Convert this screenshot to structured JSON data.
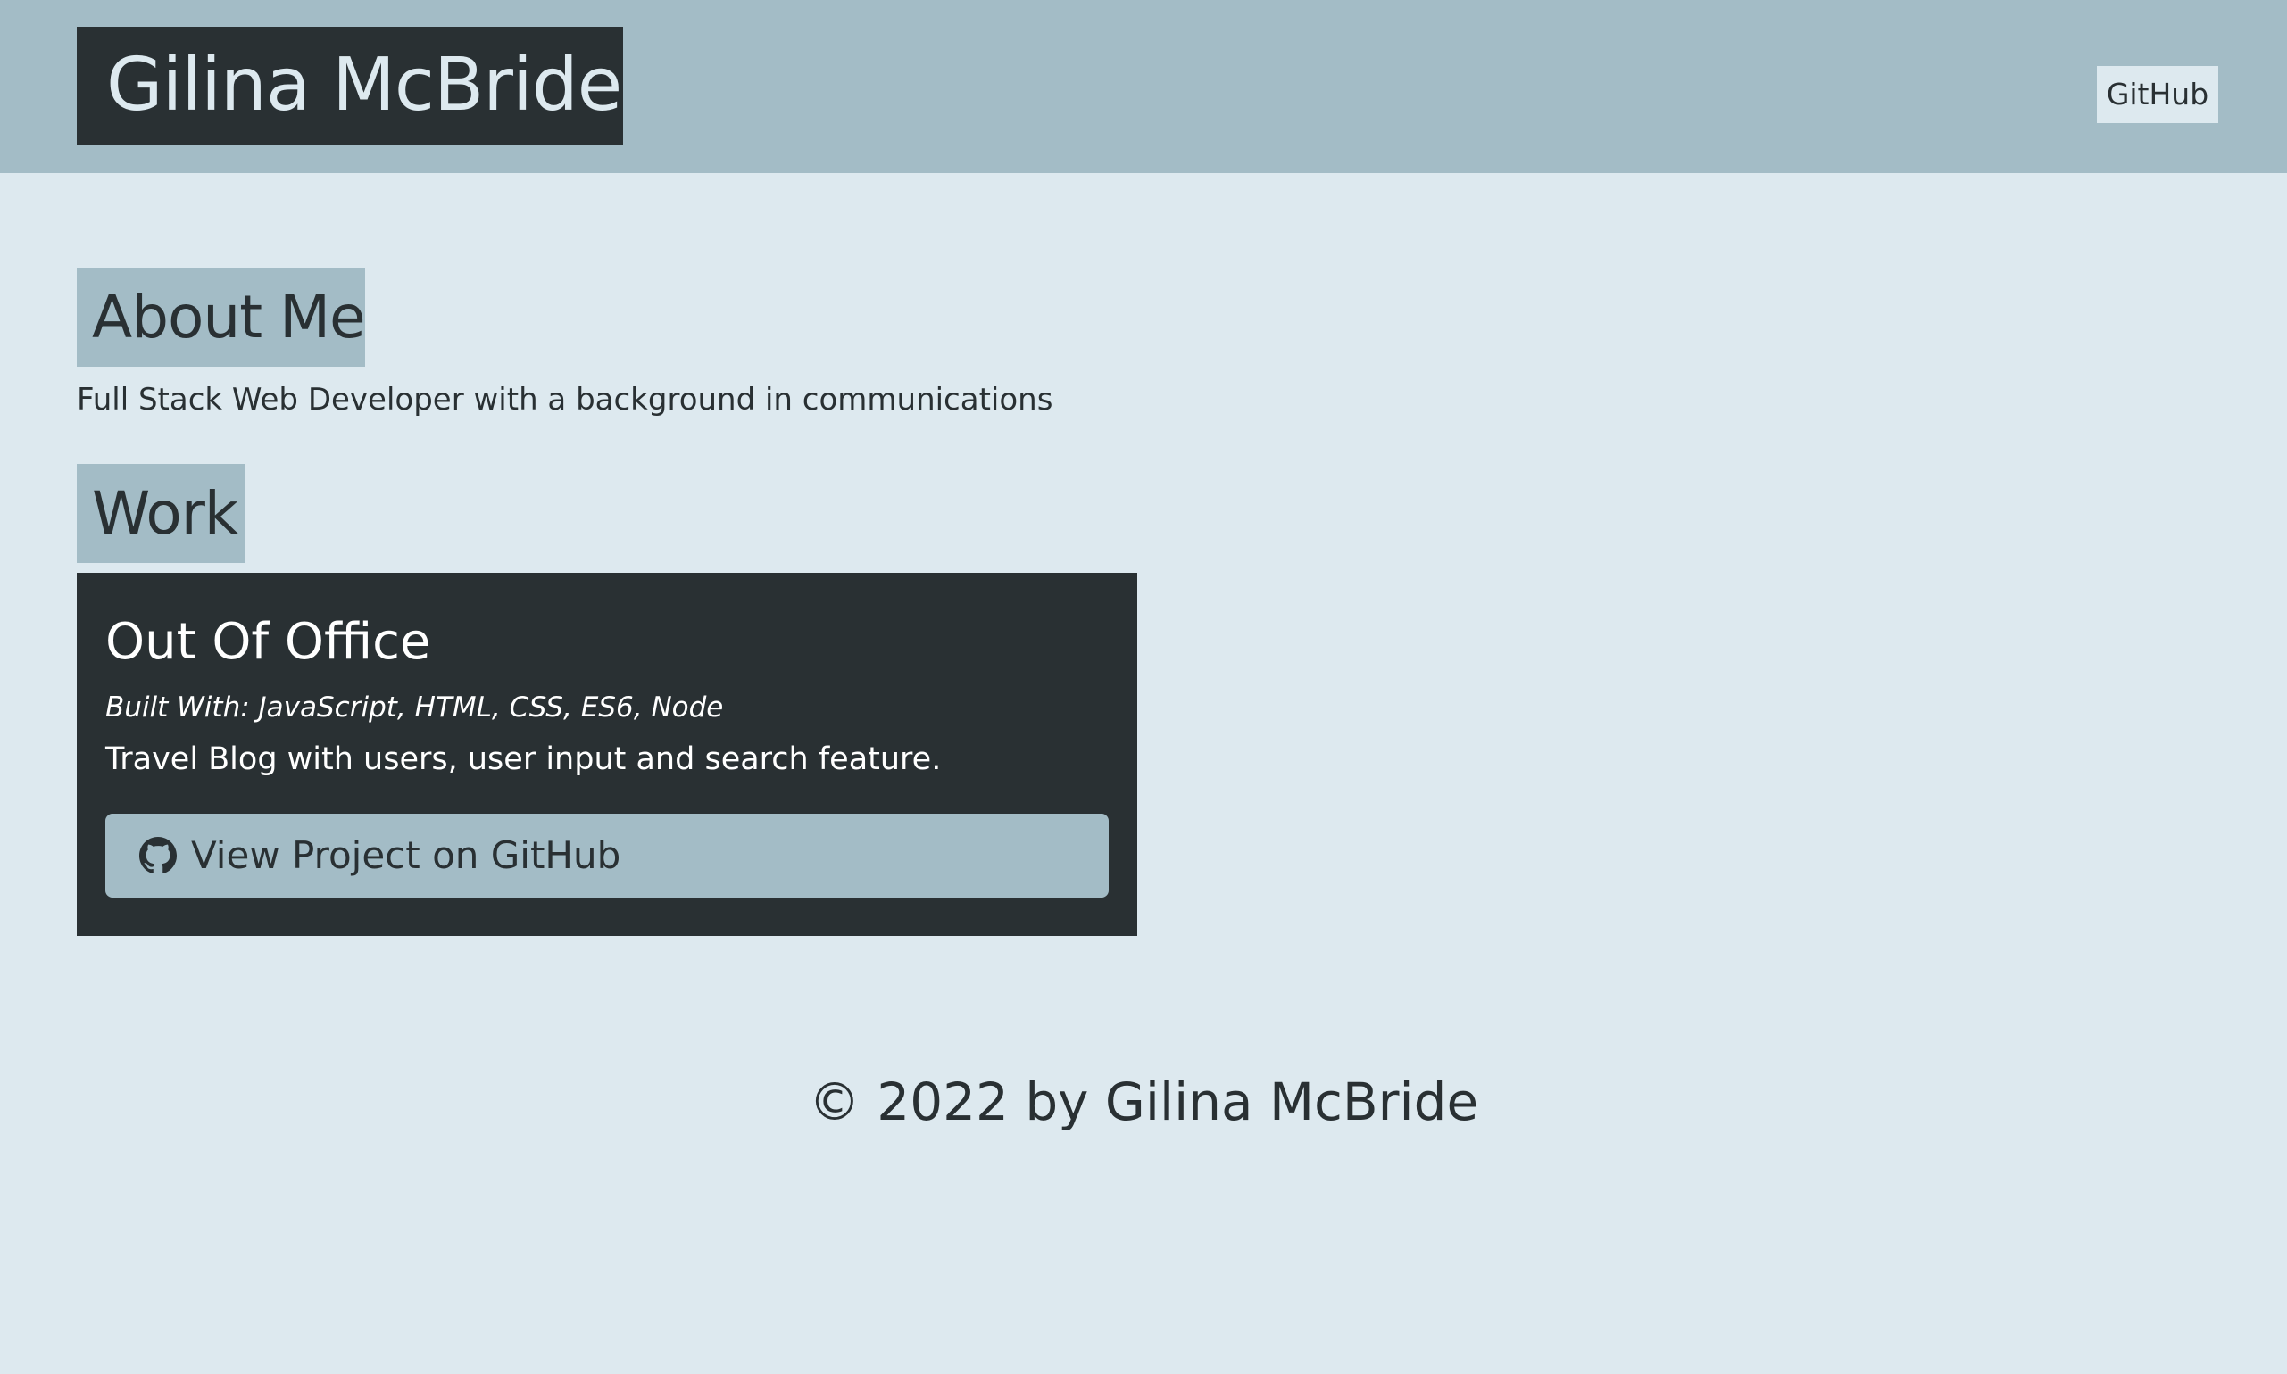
{
  "header": {
    "brand_name": "Gilina McBride",
    "nav_link_label": "GitHub"
  },
  "about": {
    "heading": "About Me",
    "text": "Full Stack Web Developer with a background in communications"
  },
  "work": {
    "heading": "Work",
    "projects": [
      {
        "title": "Out Of Office",
        "built_with": "Built With: JavaScript, HTML, CSS, ES6, Node",
        "description": "Travel Blog with users, user input and search feature.",
        "button_label": "View Project on GitHub",
        "button_icon": "github-icon"
      }
    ]
  },
  "footer": {
    "copyright": "© 2022 by Gilina McBride"
  },
  "colors": {
    "page_background": "#dde9ef",
    "header_background": "#a3bcc6",
    "dark": "#293033"
  }
}
